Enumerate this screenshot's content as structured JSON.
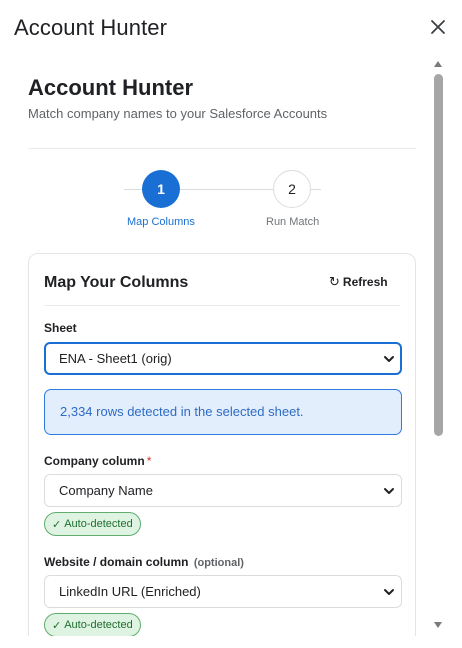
{
  "window": {
    "title": "Account Hunter",
    "close_icon": "close-icon"
  },
  "header": {
    "title": "Account Hunter",
    "subtitle": "Match company names to your Salesforce Accounts"
  },
  "stepper": {
    "active_step": 1,
    "steps": [
      {
        "number": "1",
        "label": "Map Columns"
      },
      {
        "number": "2",
        "label": "Run Match"
      }
    ]
  },
  "card": {
    "title": "Map Your Columns",
    "refresh_label": "Refresh",
    "refresh_icon": "refresh-icon"
  },
  "sheet": {
    "label": "Sheet",
    "value": "ENA - Sheet1 (orig)"
  },
  "info": {
    "text": "2,334 rows detected in the selected sheet."
  },
  "company": {
    "label": "Company column",
    "required_mark": "*",
    "value": "Company Name",
    "badge": "Auto-detected"
  },
  "website": {
    "label": "Website / domain column",
    "optional_mark": "(optional)",
    "value": "LinkedIn URL (Enriched)",
    "badge": "Auto-detected"
  },
  "colors": {
    "accent": "#1a6fd4",
    "info_bg": "#e3eefc",
    "info_text": "#2e6bc5",
    "badge_bg": "#dff3e2",
    "badge_text": "#1e6e2e",
    "required": "#d93025"
  }
}
